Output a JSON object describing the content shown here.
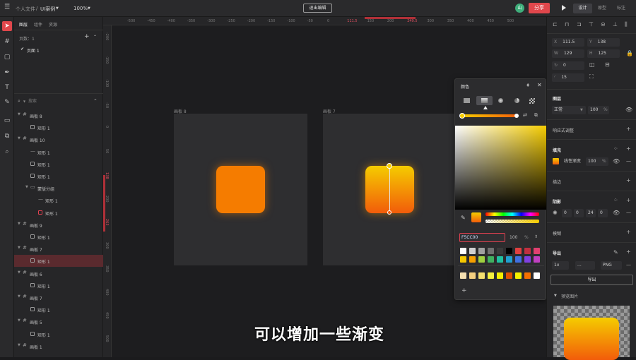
{
  "topbar": {
    "breadcrumb_root": "个人文件",
    "breadcrumb_sep": "/",
    "breadcrumb_file": "UI案例",
    "zoom": "100%",
    "exit_label": "退出编辑",
    "avatar": "山",
    "share_label": "分享",
    "modes": [
      "设计",
      "原型",
      "标注"
    ]
  },
  "left": {
    "tabs": [
      "图层",
      "组件",
      "资源"
    ],
    "pages_label": "页数：1",
    "page_item": "页面 1",
    "search_placeholder": "搜索",
    "layers": [
      {
        "label": "画板 8",
        "type": "frame",
        "depth": 0
      },
      {
        "label": "矩形 1",
        "type": "rect",
        "depth": 1
      },
      {
        "label": "画板 10",
        "type": "frame",
        "depth": 0
      },
      {
        "label": "矩形 1",
        "type": "line",
        "depth": 1
      },
      {
        "label": "矩形 1",
        "type": "rect",
        "depth": 1
      },
      {
        "label": "矩形 1",
        "type": "rect",
        "depth": 1
      },
      {
        "label": "蒙版分组",
        "type": "folder",
        "depth": 1
      },
      {
        "label": "矩形 1",
        "type": "line",
        "depth": 2
      },
      {
        "label": "矩形 1",
        "type": "rectred",
        "depth": 2
      },
      {
        "label": "画板 9",
        "type": "frame",
        "depth": 0
      },
      {
        "label": "矩形 1",
        "type": "rect",
        "depth": 1
      },
      {
        "label": "画板 7",
        "type": "frame",
        "depth": 0
      },
      {
        "label": "矩形 1",
        "type": "rect",
        "depth": 1,
        "selected": true
      },
      {
        "label": "画板 6",
        "type": "frame",
        "depth": 0
      },
      {
        "label": "矩形 1",
        "type": "rect",
        "depth": 1
      },
      {
        "label": "画板 7",
        "type": "frame",
        "depth": 0
      },
      {
        "label": "矩形 1",
        "type": "rect",
        "depth": 1
      },
      {
        "label": "画板 5",
        "type": "frame",
        "depth": 0
      },
      {
        "label": "矩形 1",
        "type": "rect",
        "depth": 1
      },
      {
        "label": "画板 1",
        "type": "frame",
        "depth": 0
      }
    ]
  },
  "canvas": {
    "ruler_top": [
      "-500",
      "-450",
      "-400",
      "-350",
      "-300",
      "-250",
      "-200",
      "-150",
      "-100",
      "-50",
      "0",
      "111.5",
      "150",
      "200",
      "249.5",
      "300",
      "350",
      "400",
      "450",
      "500"
    ],
    "ruler_left": [
      "-200",
      "-150",
      "-100",
      "-50",
      "0",
      "50",
      "138",
      "200",
      "263",
      "300",
      "350",
      "400",
      "450",
      "500"
    ],
    "artboard_left_label": "画板 8",
    "artboard_right_label": "画板 7"
  },
  "color_popup": {
    "title": "颜色",
    "hex": "F5CC00",
    "opacity": "100",
    "opacity_unit": "%",
    "swatches_row1": [
      "#ffffff",
      "#d0d0d0",
      "#a0a0a0",
      "#707070",
      "#3a3a3a",
      "#000000",
      "#e04040",
      "#c03040",
      "#e04070"
    ],
    "swatches_row2": [
      "#f5c800",
      "#f5a000",
      "#a0d040",
      "#40b060",
      "#20c0a0",
      "#20a0d0",
      "#4070e0",
      "#8040e0",
      "#c040c0"
    ],
    "swatches_row3": [
      "#f5e0b0",
      "#f5d080",
      "#f5e070",
      "#f5f040",
      "#f5f000",
      "#e05000",
      "#f5f000",
      "#f57000",
      "#ffffff"
    ],
    "colors": {
      "fill_top": "#f5cc00",
      "fill_bottom": "#f25c0a",
      "flat_orange": "#f57c00"
    }
  },
  "right": {
    "x_label": "X",
    "x": "111.5",
    "y_label": "Y",
    "y": "138",
    "w_label": "W",
    "w": "129",
    "h_label": "H",
    "h": "125",
    "rot": "0",
    "radius": "15",
    "layer_title": "图层",
    "blend": "正常",
    "layer_opacity": "100",
    "pct": "%",
    "responsive": "响应式调整",
    "fill_title": "填充",
    "fill_type": "线性渐变",
    "fill_opacity": "100",
    "stroke_title": "描边",
    "shadow_title": "阴影",
    "shadow_vals": [
      "0",
      "0",
      "24",
      "0"
    ],
    "blur_title": "模糊",
    "export_title": "导出",
    "export_scale": "1x",
    "export_suffix": "...",
    "export_format": "PNG",
    "export_btn": "导出",
    "preview_label": "预览图片"
  },
  "subtitle": "可以增加一些渐变"
}
